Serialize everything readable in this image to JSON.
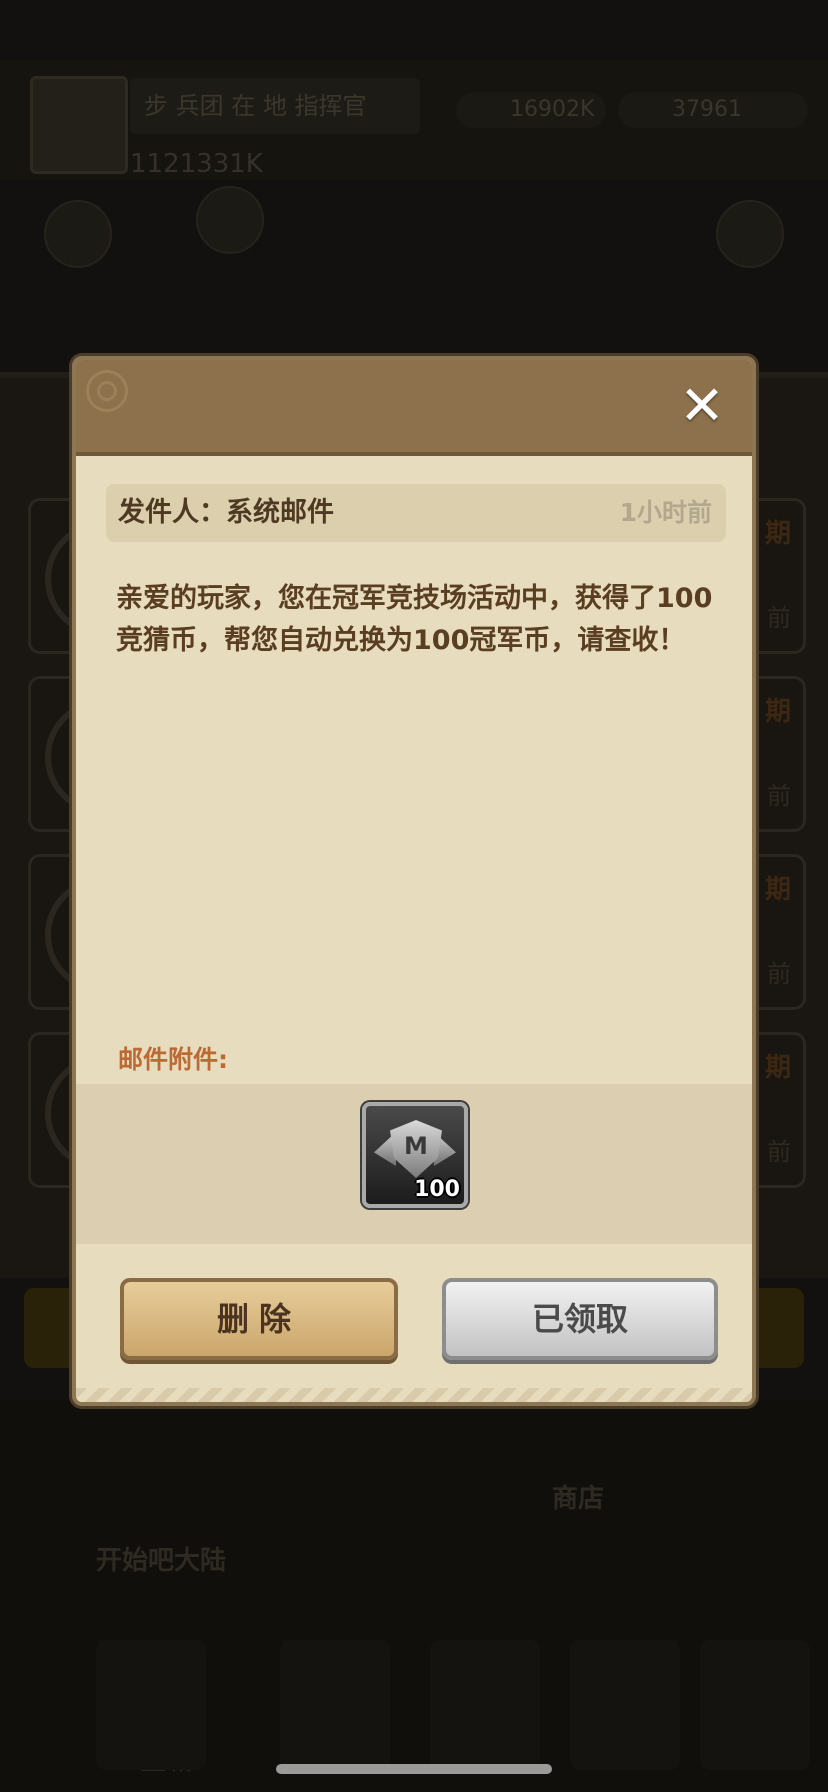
{
  "background": {
    "player_name": "步 兵团 在 地 指挥官",
    "resource_1": "16902K",
    "resource_2": "37961",
    "power": "1121331K",
    "rows": [
      {
        "tag": "期",
        "sub": "前"
      },
      {
        "tag": "期",
        "sub": "前"
      },
      {
        "tag": "期",
        "sub": "前"
      },
      {
        "tag": "期",
        "sub": "前"
      }
    ],
    "shop_label": "商店",
    "bottom_label_1": "开始吧大陆",
    "bottom_label_2": "主城"
  },
  "dialog": {
    "close_icon": "✕",
    "sender_label": "发件人：系统邮件",
    "time_ago": "1小时前",
    "body": "亲爱的玩家，您在冠军竞技场活动中，获得了100竞猜币，帮您自动兑换为100冠军币，请查收！",
    "attachment_label": "邮件附件:",
    "attachment": {
      "icon": "champion-coin-icon",
      "badge_letter": "M",
      "quantity": "100"
    },
    "delete_button": "删除",
    "claimed_button": "已领取"
  },
  "colors": {
    "dialog_bg": "#e8dcbe",
    "header": "#8c714c",
    "delete_button": "#d9b97f",
    "claimed_button": "#d9d9d9",
    "attachment_label": "#bb6a33"
  }
}
